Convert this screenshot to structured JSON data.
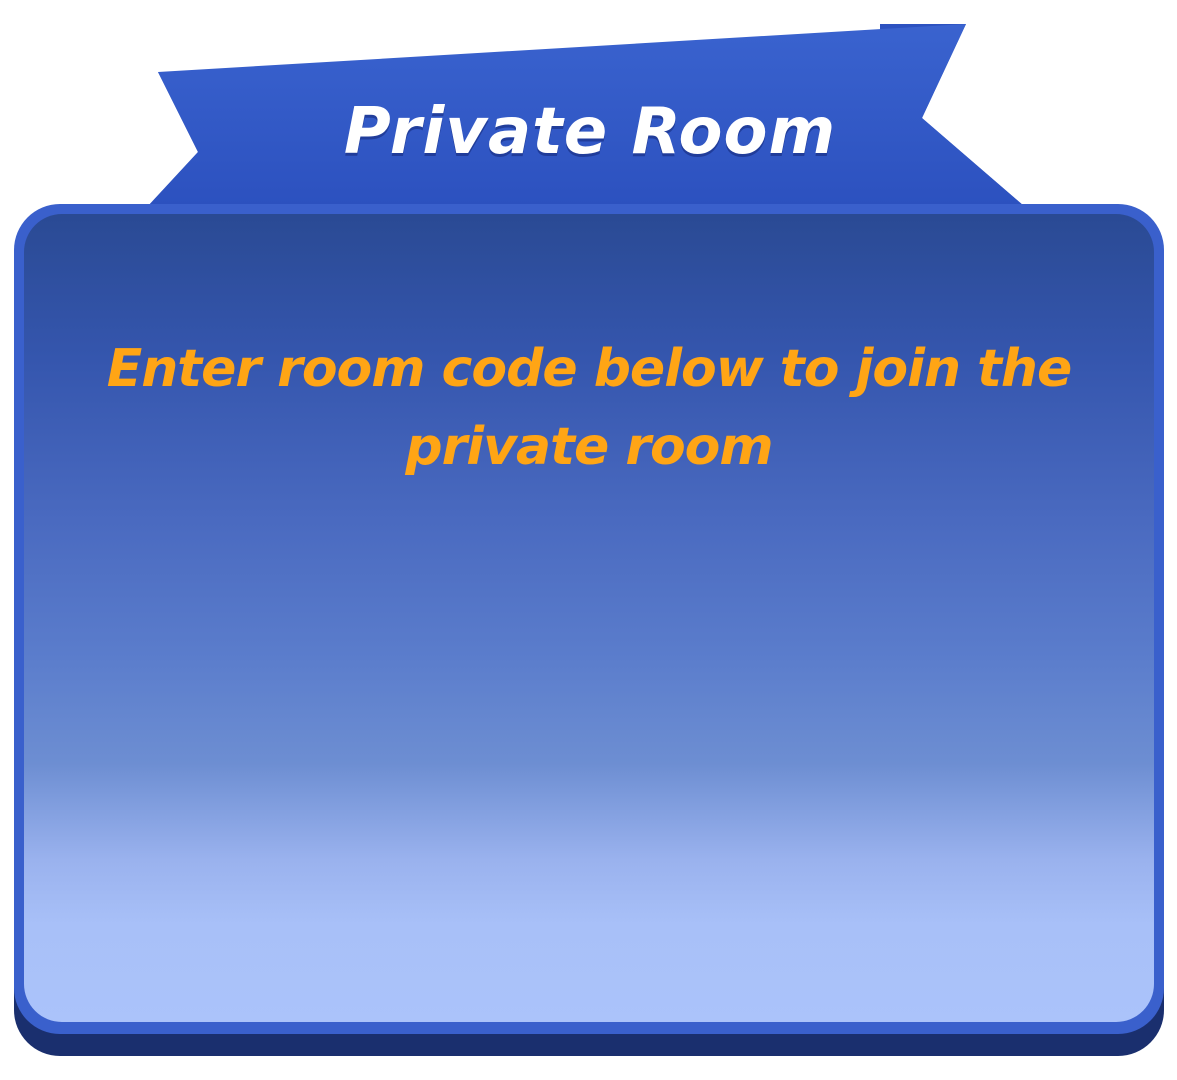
{
  "dialog": {
    "title": "Private Room",
    "message": "Enter room code below to join the private room"
  },
  "colors": {
    "banner": "#2f58c6",
    "panel_top": "#2a4a94",
    "panel_bottom": "#abc3fa",
    "panel_rim": "#3a60cc",
    "message_text": "#ffa515",
    "title_text": "#ffffff"
  }
}
